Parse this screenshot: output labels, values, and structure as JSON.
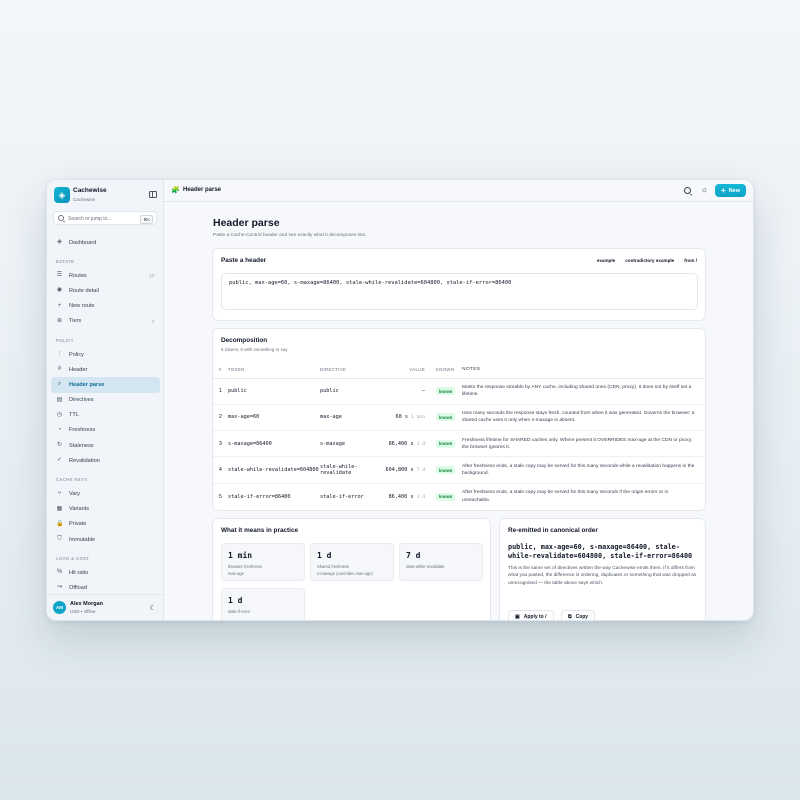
{
  "app": {
    "name": "Cachewise",
    "sub": "Cachewise",
    "logo_icon": "layers-icon",
    "accent": "#0ea5c9"
  },
  "search": {
    "placeholder": "Search or jump to...",
    "shortcut": "⌘K"
  },
  "nav": {
    "top": [
      {
        "label": "Dashboard",
        "icon": "layers-icon",
        "glyph": "◈"
      }
    ],
    "sections": [
      {
        "title": "ESTATE",
        "items": [
          {
            "label": "Routes",
            "icon": "list-icon",
            "glyph": "☰",
            "count": "13"
          },
          {
            "label": "Route detail",
            "icon": "eye-icon",
            "glyph": "◉"
          },
          {
            "label": "New route",
            "icon": "plus-icon",
            "glyph": "+"
          },
          {
            "label": "Tiers",
            "icon": "globe-icon",
            "glyph": "⊕",
            "count": "4"
          }
        ]
      },
      {
        "title": "POLICY",
        "items": [
          {
            "label": "Policy",
            "icon": "sliders-icon",
            "glyph": "⫶"
          },
          {
            "label": "Header",
            "icon": "hash-icon",
            "glyph": "#"
          },
          {
            "label": "Header parse",
            "icon": "search-icon",
            "glyph": "⌕",
            "active": true
          },
          {
            "label": "Directives",
            "icon": "book-icon",
            "glyph": "▤"
          },
          {
            "label": "TTL",
            "icon": "clock-icon",
            "glyph": "◷"
          },
          {
            "label": "Freshness",
            "icon": "gauge-icon",
            "glyph": "◔"
          },
          {
            "label": "Staleness",
            "icon": "refresh-icon",
            "glyph": "↻"
          },
          {
            "label": "Revalidation",
            "icon": "check-icon",
            "glyph": "✓"
          }
        ]
      },
      {
        "title": "CACHE KEYS",
        "items": [
          {
            "label": "Vary",
            "icon": "branch-icon",
            "glyph": "⑂"
          },
          {
            "label": "Variants",
            "icon": "grid-icon",
            "glyph": "▦"
          },
          {
            "label": "Private",
            "icon": "lock-icon",
            "glyph": "🔒"
          },
          {
            "label": "Immutable",
            "icon": "shield-icon",
            "glyph": "⛉"
          }
        ]
      },
      {
        "title": "LOAD & COST",
        "items": [
          {
            "label": "Hit ratio",
            "icon": "percent-icon",
            "glyph": "%"
          },
          {
            "label": "Offload",
            "icon": "trend-icon",
            "glyph": "↝"
          }
        ]
      }
    ]
  },
  "user": {
    "initials": "AM",
    "name": "Alex Morgan",
    "sub": "USD • offline"
  },
  "topbar": {
    "title": "Header parse",
    "icon": "puzzle-icon",
    "new_label": "New"
  },
  "page": {
    "title": "Header parse",
    "subtitle": "Paste a Cache-Control header and see exactly what it decomposes into."
  },
  "paste": {
    "title": "Paste a header",
    "links": [
      "example",
      "contradictory example",
      "from /"
    ],
    "value": "public, max-age=60, s-maxage=86400, stale-while-revalidate=604800, stale-if-error=86400"
  },
  "decomposition": {
    "title": "Decomposition",
    "subtitle": "5 tokens, 0 with something to say",
    "columns": [
      "#",
      "TOKEN",
      "DIRECTIVE",
      "VALUE",
      "KNOWN",
      "NOTES"
    ],
    "rows": [
      {
        "idx": "1",
        "token": "public",
        "directive": "public",
        "value": "—",
        "unit": "",
        "known": "known",
        "notes": "Marks the response storable by ANY cache, including shared ones (CDN, proxy). It does not by itself set a lifetime."
      },
      {
        "idx": "2",
        "token": "max-age=60",
        "directive": "max-age",
        "value": "60 s",
        "unit": "1 min",
        "known": "known",
        "notes": "How many seconds the response stays fresh, counted from when it was generated. Governs the browser; a shared cache uses it only when s-maxage is absent."
      },
      {
        "idx": "3",
        "token": "s-maxage=86400",
        "directive": "s-maxage",
        "value": "86,400 s",
        "unit": "1 d",
        "known": "known",
        "notes": "Freshness lifetime for SHARED caches only. Where present it OVERRIDES max-age at the CDN or proxy; the browser ignores it."
      },
      {
        "idx": "4",
        "token": "stale-while-revalidate=604800",
        "directive": "stale-while-revalidate",
        "value": "604,800 s",
        "unit": "7 d",
        "known": "known",
        "notes": "After freshness ends, a stale copy may be served for this many seconds while a revalidation happens in the background."
      },
      {
        "idx": "5",
        "token": "stale-if-error=86400",
        "directive": "stale-if-error",
        "value": "86,400 s",
        "unit": "1 d",
        "known": "known",
        "notes": "After freshness ends, a stale copy may be served for this many seconds if the origin errors or is unreachable."
      }
    ]
  },
  "practice": {
    "title": "What it means in practice",
    "tiles": [
      {
        "value": "1 min",
        "l1": "Browser freshness",
        "l2": "max-age"
      },
      {
        "value": "1 d",
        "l1": "Shared freshness",
        "l2": "s-maxage (overrides max-age)"
      },
      {
        "value": "7 d",
        "l1": "stale-while-revalidate",
        "l2": ""
      },
      {
        "value": "1 d",
        "l1": "stale-if-error",
        "l2": ""
      }
    ]
  },
  "canonical": {
    "title": "Re-emitted in canonical order",
    "code": "public, max-age=60, s-maxage=86400, stale-while-revalidate=604800, stale-if-error=86400",
    "desc": "This is the same set of directives written the way Cachewise emits them. If it differs from what you pasted, the difference is ordering, duplicates or something that was dropped as unrecognised — the table above says which.",
    "apply_label": "Apply to /",
    "copy_label": "Copy"
  }
}
